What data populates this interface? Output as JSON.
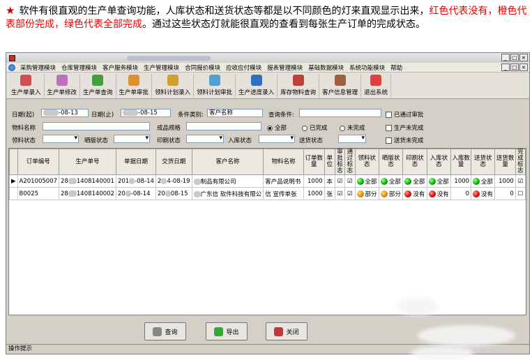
{
  "intro": {
    "part1": "软件有很直观的生产单查询功能，人库状态和送货状态等都是以不同颜色的灯来直观显示出来，",
    "part2": "红色代表没有，橙色代表部份完成，绿色代表全部完成",
    "part3": "。通过这些状态灯就能很直观的查看到每张生产订单的完成状态。"
  },
  "window": {
    "buttons": [
      "_",
      "□",
      "×"
    ],
    "inner_buttons": [
      "_",
      "□",
      "×"
    ]
  },
  "menu": [
    "采购管理模块",
    "仓库管理模块",
    "客户服务模块",
    "生产管理模块",
    "合同报价模块",
    "应收应付模块",
    "报表管理模块",
    "基础数据模块",
    "系统功能模块",
    "帮助"
  ],
  "toolbar": [
    {
      "label": "生产单录入",
      "icon": "form-entry-icon",
      "color": "#d05050"
    },
    {
      "label": "生产单修改",
      "icon": "edit-icon",
      "color": "#c070c0"
    },
    {
      "label": "生产单查询",
      "icon": "query-icon",
      "color": "#40a040"
    },
    {
      "label": "生产单审批",
      "icon": "approve-icon",
      "color": "#e09030"
    },
    {
      "label": "领料计划录入",
      "icon": "material-plan-icon",
      "color": "#d0a030"
    },
    {
      "label": "领料计划审批",
      "icon": "material-approve-icon",
      "color": "#50a0d0"
    },
    {
      "label": "生产进度录入",
      "icon": "progress-icon",
      "color": "#3070c0"
    },
    {
      "label": "库存物料查询",
      "icon": "inventory-icon",
      "color": "#c04040"
    },
    {
      "label": "客户信息管理",
      "icon": "customer-icon",
      "color": "#a06040"
    },
    {
      "label": "退出系统",
      "icon": "exit-icon",
      "color": "#e04040"
    }
  ],
  "filters": {
    "date_from_label": "日期(起)",
    "date_from": "-08-13",
    "date_to_label": "日期(止)",
    "date_to": "-08-15",
    "condition_type_label": "条件类别:",
    "condition_type_value": "客户名称",
    "query_condition_label": "查询条件:",
    "material_name_label": "物料名称",
    "product_spec_label": "成品规格",
    "radio_all": "全部",
    "radio_done": "已完成",
    "radio_undone": "未完成",
    "chk_approved": "已通过审批",
    "chk_prod_undone": "生产未完成",
    "chk_delivery_undone": "送货未完成",
    "material_status_label": "领料状态",
    "plate_status_label": "晒版状态",
    "print_status_label": "印刷状态",
    "stock_in_status_label": "入库状态",
    "delivery_status_label": "送货状态"
  },
  "table": {
    "headers": [
      "订单编号",
      "生产单号",
      "单据日期",
      "交货日期",
      "客户名称",
      "物料名称",
      "订单数量",
      "单位",
      "审批标志",
      "通过标志",
      "领料状态",
      "晒版状态",
      "印刷状态",
      "入库状态",
      "入库数量",
      "送货状态",
      "送货数量",
      "完成标志"
    ],
    "rows": [
      {
        "order_no": "A201005007",
        "prod_no_a": "28",
        "prod_no_b": "1408140001",
        "doc_date_a": "201",
        "doc_date_b": "-08-14",
        "deliv_date_a": "2",
        "deliv_date_b": "4-08-19",
        "customer": "制品有限公司",
        "material": "客产品说明书",
        "qty": "1000",
        "unit": "本",
        "approve": "☑",
        "pass": "☑",
        "mat": "全部",
        "plate": "全部",
        "print": "全部",
        "stockin": "全部",
        "stockin_qty": "1000",
        "deliv": "全部",
        "deliv_qty": "1000",
        "done": "☑",
        "mat_color": "g",
        "plate_color": "g",
        "print_color": "g",
        "stockin_color": "g",
        "deliv_color": "g"
      },
      {
        "order_no": "B0025",
        "prod_no_a": "28",
        "prod_no_b": "1408140002",
        "doc_date_a": "20",
        "doc_date_b": "-08-14",
        "deliv_date_a": "20",
        "deliv_date_b": "08-15",
        "customer": "广东信 软件科技有限公",
        "material": "信 宣传单张",
        "qty": "1000",
        "unit": "张",
        "approve": "☑",
        "pass": "☑",
        "mat": "部分",
        "plate": "部分",
        "print": "没有",
        "stockin": "没有",
        "stockin_qty": "0",
        "deliv": "没有",
        "deliv_qty": "0",
        "done": "☐",
        "mat_color": "o",
        "plate_color": "o",
        "print_color": "rd",
        "stockin_color": "rd",
        "deliv_color": "rd"
      }
    ]
  },
  "bottom": {
    "query": "查询",
    "export": "导出",
    "close": "关闭"
  },
  "status": "操作提示"
}
